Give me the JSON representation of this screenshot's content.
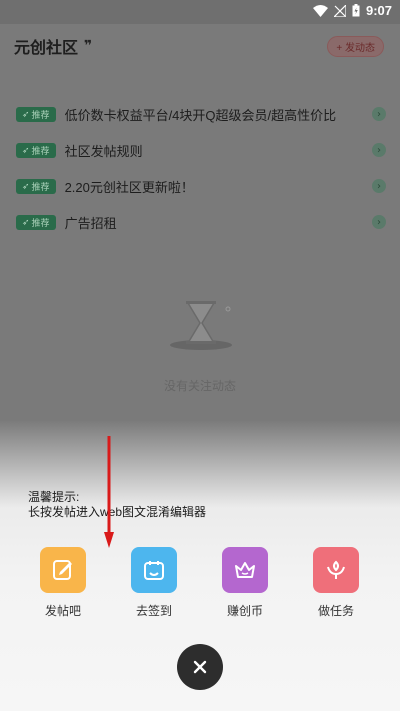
{
  "statusbar": {
    "time": "9:07"
  },
  "header": {
    "title": "元创社区",
    "post_button": "+ 发动态"
  },
  "notices": [
    {
      "tag": "推荐",
      "text": "低价数卡权益平台/4块开Q超级会员/超高性价比"
    },
    {
      "tag": "推荐",
      "text": "社区发帖规则"
    },
    {
      "tag": "推荐",
      "text": "2.20元创社区更新啦！"
    },
    {
      "tag": "推荐",
      "text": "广告招租"
    }
  ],
  "empty_state": {
    "text": "没有关注动态"
  },
  "tip": {
    "line1": "温馨提示:",
    "line2": "长按发帖进入web图文混淆编辑器"
  },
  "actions": [
    {
      "label": "发帖吧",
      "color": "#f9b54a"
    },
    {
      "label": "去签到",
      "color": "#4db6ee"
    },
    {
      "label": "赚创币",
      "color": "#b467cf"
    },
    {
      "label": "做任务",
      "color": "#ef6f7a"
    }
  ],
  "colors": {
    "tag_bg": "#2a6b4a",
    "close_bg": "#2d2d2d",
    "arrow": "#d91a1a"
  }
}
